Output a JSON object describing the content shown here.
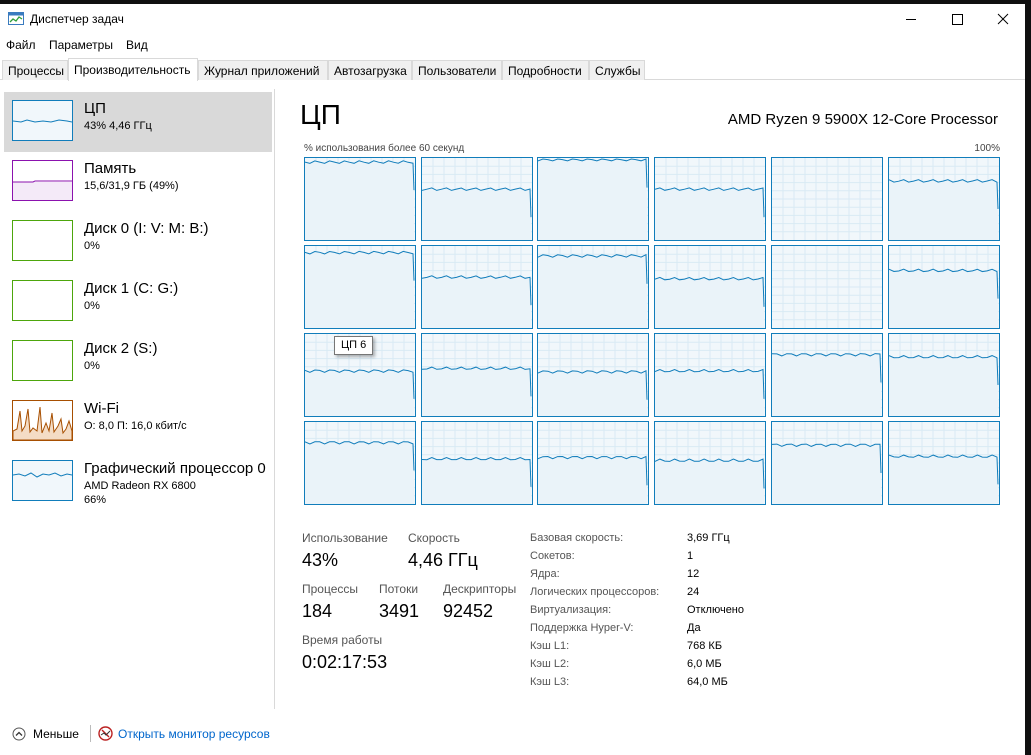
{
  "window": {
    "title": "Диспетчер задач"
  },
  "menu": [
    "Файл",
    "Параметры",
    "Вид"
  ],
  "tabs": [
    "Процессы",
    "Производительность",
    "Журнал приложений",
    "Автозагрузка",
    "Пользователи",
    "Подробности",
    "Службы"
  ],
  "sidebar": {
    "items": [
      {
        "title": "ЦП",
        "sub1": "43% 4,46 ГГц",
        "sub2": "",
        "color": "#117dbb"
      },
      {
        "title": "Память",
        "sub1": "15,6/31,9 ГБ (49%)",
        "sub2": "",
        "color": "#8b12ae"
      },
      {
        "title": "Диск 0 (I: V: M: B:)",
        "sub1": "0%",
        "sub2": "",
        "color": "#4da60c"
      },
      {
        "title": "Диск 1 (C: G:)",
        "sub1": "0%",
        "sub2": "",
        "color": "#4da60c"
      },
      {
        "title": "Диск 2 (S:)",
        "sub1": "0%",
        "sub2": "",
        "color": "#4da60c"
      },
      {
        "title": "Wi-Fi",
        "sub1": "О: 8,0 П: 16,0 кбит/с",
        "sub2": "",
        "color": "#a74f01"
      },
      {
        "title": "Графический процессор 0",
        "sub1": "AMD Radeon RX 6800",
        "sub2": "66%",
        "color": "#117dbb"
      }
    ]
  },
  "main": {
    "heading": "ЦП",
    "cpu_model": "AMD Ryzen 9 5900X 12-Core Processor",
    "graph_caption": "% использования более 60 секунд",
    "graph_max": "100%",
    "tooltip": "ЦП 6",
    "core_levels": [
      0.95,
      0.62,
      0.98,
      0.62,
      0.0,
      0.72,
      0.92,
      0.62,
      0.88,
      0.6,
      0.0,
      0.7,
      0.55,
      0.58,
      0.54,
      0.55,
      0.75,
      0.72,
      0.75,
      0.55,
      0.57,
      0.53,
      0.72,
      0.58
    ]
  },
  "stats": {
    "usage_label": "Использование",
    "usage_value": "43%",
    "speed_label": "Скорость",
    "speed_value": "4,46 ГГц",
    "processes_label": "Процессы",
    "processes_value": "184",
    "threads_label": "Потоки",
    "threads_value": "3491",
    "handles_label": "Дескрипторы",
    "handles_value": "92452",
    "uptime_label": "Время работы",
    "uptime_value": "0:02:17:53"
  },
  "specs": [
    {
      "label": "Базовая скорость:",
      "value": "3,69 ГГц"
    },
    {
      "label": "Сокетов:",
      "value": "1"
    },
    {
      "label": "Ядра:",
      "value": "12"
    },
    {
      "label": "Логических процессоров:",
      "value": "24"
    },
    {
      "label": "Виртуализация:",
      "value": "Отключено"
    },
    {
      "label": "Поддержка Hyper-V:",
      "value": "Да"
    },
    {
      "label": "Кэш L1:",
      "value": "768 КБ"
    },
    {
      "label": "Кэш L2:",
      "value": "6,0 МБ"
    },
    {
      "label": "Кэш L3:",
      "value": "64,0 МБ"
    }
  ],
  "footer": {
    "less": "Меньше",
    "monitor": "Открыть монитор ресурсов"
  },
  "colors": {
    "cpu": "#117dbb",
    "memory": "#8b12ae",
    "disk": "#4da60c",
    "wifi": "#a74f01",
    "link": "#0066cc"
  }
}
